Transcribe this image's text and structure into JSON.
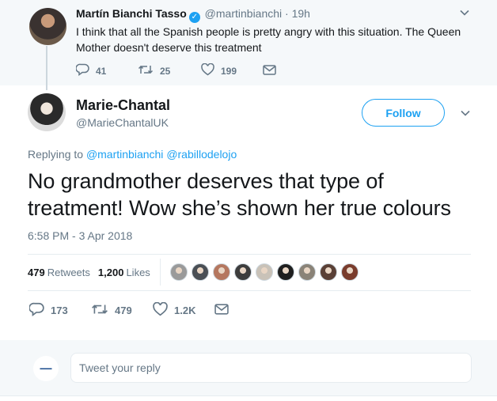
{
  "parent_tweet": {
    "name": "Martín Bianchi Tasso",
    "handle": "@martinbianchi",
    "time": "· 19h",
    "text": "I think that all the Spanish people is pretty angry with this situation. The Queen Mother doesn't deserve this treatment",
    "replies": "41",
    "retweets": "25",
    "likes": "199"
  },
  "main_tweet": {
    "name": "Marie-Chantal",
    "handle": "@MarieChantalUK",
    "follow_label": "Follow",
    "replying_prefix": "Replying to",
    "replying_to_1": "@martinbianchi",
    "replying_to_2": "@rabillodelojo",
    "text": "No grandmother deserves that type of treatment! Wow she’s shown her true colours",
    "timestamp": "6:58 PM - 3 Apr 2018",
    "retweet_count": "479",
    "retweet_label": "Retweets",
    "like_count": "1,200",
    "like_label": "Likes",
    "liker_colors": [
      "#9a9a9a",
      "#4a4f55",
      "#b5775f",
      "#3d3d3d",
      "#c9c2b8",
      "#1f1f1f",
      "#8a8378",
      "#5a4036",
      "#7a3c2c"
    ],
    "action_replies": "173",
    "action_retweets": "479",
    "action_likes": "1.2K"
  },
  "reply_box": {
    "placeholder": "Tweet your reply"
  },
  "icons": {
    "reply": "reply-icon",
    "retweet": "retweet-icon",
    "like": "heart-icon",
    "message": "envelope-icon",
    "more": "chevron-down-icon"
  }
}
